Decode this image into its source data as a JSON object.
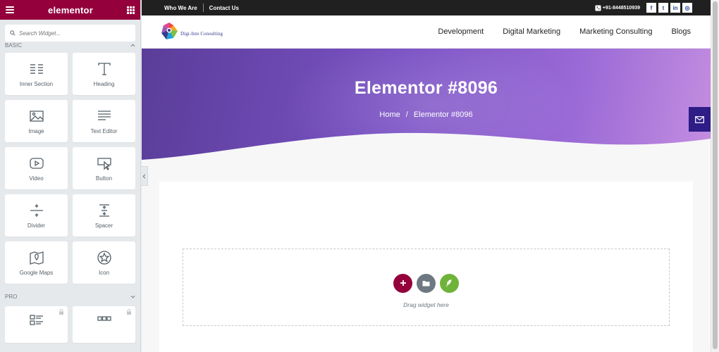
{
  "sidebar": {
    "brand": "elementor",
    "search_placeholder": "Search Widget...",
    "basic_category": "BASIC",
    "pro_category": "PRO",
    "widgets": [
      {
        "label": "Inner Section",
        "icon": "inner-section-icon"
      },
      {
        "label": "Heading",
        "icon": "heading-icon"
      },
      {
        "label": "Image",
        "icon": "image-icon"
      },
      {
        "label": "Text Editor",
        "icon": "text-editor-icon"
      },
      {
        "label": "Video",
        "icon": "video-icon"
      },
      {
        "label": "Button",
        "icon": "button-icon"
      },
      {
        "label": "Divider",
        "icon": "divider-icon"
      },
      {
        "label": "Spacer",
        "icon": "spacer-icon"
      },
      {
        "label": "Google Maps",
        "icon": "map-icon"
      },
      {
        "label": "Icon",
        "icon": "star-icon"
      }
    ]
  },
  "site": {
    "topbar": {
      "link1": "Who We Are",
      "link2": "Contact Us",
      "phone": "+91-8448510939",
      "social": [
        {
          "icon": "facebook-icon",
          "glyph": "f"
        },
        {
          "icon": "twitter-icon",
          "glyph": "t"
        },
        {
          "icon": "linkedin-icon",
          "glyph": "in"
        },
        {
          "icon": "instagram-icon",
          "glyph": "◎"
        }
      ]
    },
    "logo_text": "Digi-Inte Consulting",
    "menu": [
      "Development",
      "Digital Marketing",
      "Marketing Consulting",
      "Blogs"
    ],
    "hero": {
      "title": "Elementor #8096",
      "breadcrumb_home": "Home",
      "breadcrumb_sep": "/",
      "breadcrumb_current": "Elementor #8096"
    },
    "dropzone_label": "Drag widget here"
  },
  "colors": {
    "elementor_brand": "#93003c",
    "hero_start": "#5a3d99",
    "hero_end": "#c48ee0",
    "mail_button": "#2e1c87",
    "kit_green": "#6fb33a"
  }
}
